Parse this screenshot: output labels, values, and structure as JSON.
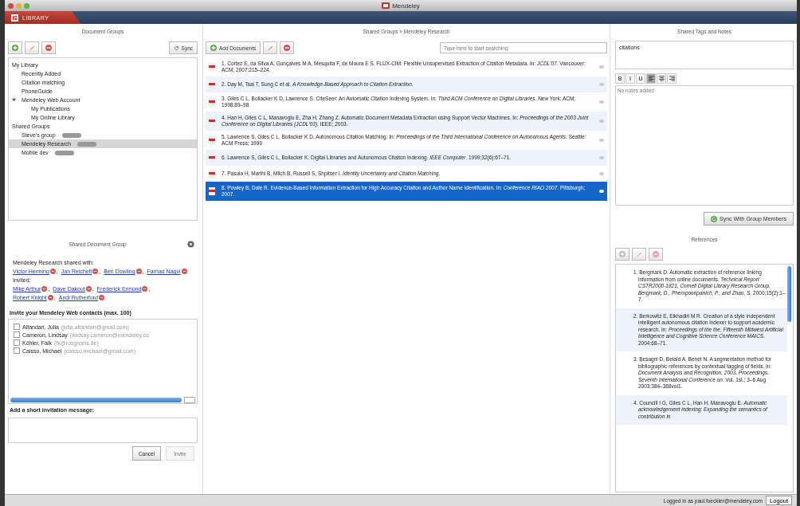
{
  "window": {
    "title": "Mendeley"
  },
  "tabs": [
    {
      "label": "LIBRARY",
      "selected": true
    }
  ],
  "document_groups": {
    "title": "Document Groups",
    "sync_label": "Sync",
    "tree": [
      {
        "label": "My Library",
        "selected": false,
        "children": [
          {
            "label": "Recently Added",
            "selected": false
          },
          {
            "label": "Citation matching",
            "selected": false
          },
          {
            "label": "PhoneGuide",
            "selected": false
          },
          {
            "label": "Mendeley Web Account",
            "selected": false,
            "expanded": true,
            "children": [
              {
                "label": "My Publications",
                "selected": false
              },
              {
                "label": "My Online Library",
                "selected": false
              }
            ]
          }
        ]
      },
      {
        "label": "Shared Groups",
        "selected": false,
        "children": [
          {
            "label": "Steve's group",
            "selected": false,
            "badge": true
          },
          {
            "label": "Mendeley Research",
            "selected": true,
            "badge": true
          },
          {
            "label": "Mobile dev",
            "selected": false,
            "badge": true
          }
        ]
      }
    ]
  },
  "shared_group": {
    "title": "Shared Document Group",
    "shared_with_label": "Mendeley Research shared with:",
    "members": [
      {
        "name": "Victor Henning",
        "after": ","
      },
      {
        "name": "Jan Reichelt",
        "after": ","
      },
      {
        "name": "Ben Dowling",
        "after": ","
      },
      {
        "name": "Farhad Naqvi"
      }
    ],
    "invited_label": "Invited:",
    "invited": [
      {
        "name": "Mike Arthur",
        "after": ","
      },
      {
        "name": "Dave Dakout",
        "after": ","
      },
      {
        "name": "Frederick Ermond",
        "after": ","
      },
      {
        "name": "Robert Knight",
        "after": ","
      },
      {
        "name": "Andi Rutherford"
      }
    ],
    "invite_title": "Invite your Mendeley Web contacts (max. 100)",
    "contacts": [
      {
        "name": "Alfandari, Julia",
        "email": "(julia.alfandari@gmail.com)",
        "checked": false
      },
      {
        "name": "Cameron, Lindsay",
        "email": "(lindsay.cameron@mendeley.co",
        "checked": false
      },
      {
        "name": "Köhler, Falk",
        "email": "(fk@rosgnahs.de)",
        "checked": false
      },
      {
        "name": "Caisso, Michael",
        "email": "(caisso.michael@gmail.com)",
        "checked": false
      }
    ],
    "message_label": "Add a short invitation message:",
    "buttons": [
      {
        "label": "Cancel",
        "disabled": false
      },
      {
        "label": "Invite",
        "disabled": true
      }
    ]
  },
  "documents": {
    "title": "Shared Groups » Mendeley Research",
    "add_label": "Add Documents",
    "search": {
      "placeholder": "Type here to start searching"
    },
    "rows": [
      {
        "text": "1. Cortez E, da Silva A, Gonçalves M A, Mesquita F, de Moura E S. FLUX-CIM: Flexible Unsupervised Extraction of Citation Metadata. In: *JCDL'07*. Vancouver: ACM; 2007:215–224.",
        "selected": false
      },
      {
        "text": "2. Day M, Tsai T, Sung C et al. *A Knowledge-Based Approach to Citation Extraction.*",
        "selected": false
      },
      {
        "text": "3. Giles C L, Bollacker K D, Lawrence S. CiteSeer: An Automatic Citation Indexing System. In: *Third ACM Conference on Digital Libraries*. New York: ACM; 1998:89–98.",
        "selected": false
      },
      {
        "text": "4. Han H, Giles C L, Manavoglu E, Zha H, Zhang Z. Automatic Document Metadata Extraction using Support Vector Machines. In: *Proceedings of the 2003 Joint Conference on Digital Libraries (JCDL'03)*. IEEE; 2003.",
        "selected": false
      },
      {
        "text": "5. Lawrence S, Giles C L, Bollacker K D. Autonomous Citation Matching. In: *Proceedings of the Third International Conference on Autonomous Agents*. Seattle: ACM Press; 1999.",
        "selected": false
      },
      {
        "text": "6. Lawrence S, Giles C L, Bollacker K. Digital Libraries and Autonomous Citation Indexing. *IEEE Computer*. 1999;32(6):67–71.",
        "selected": false
      },
      {
        "text": "7. Pasula H, Marthi B, Milch B, Russell S, Shpitser I. *Identity Uncertainty and Citation Matching.*",
        "selected": false
      },
      {
        "text": "8. Powley B, Dale R. Evidence-Based Information Extraction for High Accuracy Citation and Author Name Identification. In: *Conference RIAO 2007*. Pittsburgh; 2007.",
        "selected": true
      }
    ]
  },
  "notes": {
    "title": "Shared Tags and Notes",
    "tags": "citations",
    "format_buttons": [
      {
        "kind": "text",
        "label": "B",
        "selected": false
      },
      {
        "kind": "text",
        "label": "I",
        "selected": false
      },
      {
        "kind": "text",
        "label": "U",
        "selected": false
      },
      {
        "kind": "align-left",
        "selected": true
      },
      {
        "kind": "align-center",
        "selected": false
      },
      {
        "kind": "align-right",
        "selected": false
      }
    ],
    "notes_placeholder": "No notes added",
    "sync_label": "Sync With Group Members"
  },
  "references": {
    "title": "References",
    "items": [
      "1. Bergmark D. Automatic extraction of reference linking information from online documents. *Technical Report CSTR2000-1821, Cornell Digital Library Research Group. Bergmark, D., Phempoonpanich, P., and Zhao, S.* 2000;15(2):1–7.",
      "2. Berkowitz E, Elkhadiri M R. Creation of a style independent intelligent autonomous citation indexer to support academic research. In: *Proceedings of the the. Fifteenth Midwest Artificial Intelligence and Cognitive Science Conference MAICS*. 2004:68–71.",
      "3. Besagni D, Belaïd A, Benet N. A segmentation method for bibliographic references by contextual tagging of fields. In: *Document Analysis and Recognition, 2003. Proceedings. Seventh International Conference on*. Vol. 1st.; 3–6 Aug 2003:384–388vol1.",
      "4. Councill I G, Giles C L, Han H, Manavoglu E. *Automatic acknowledgement indexing: Expanding the semantics of contribution in*"
    ]
  },
  "status_bar": {
    "text": "Logged in as paul.foeckler@mendeley.com",
    "logout_label": "Logout"
  }
}
